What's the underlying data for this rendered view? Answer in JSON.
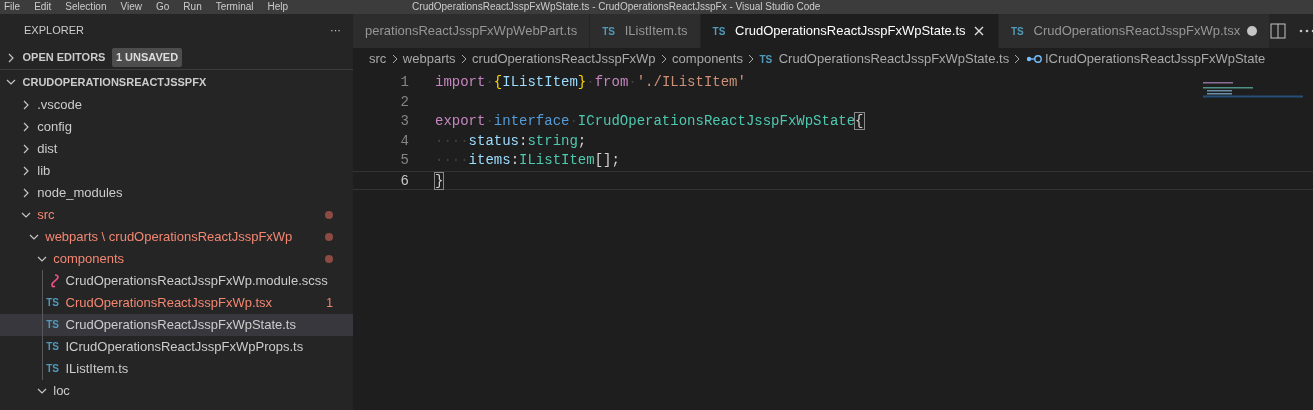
{
  "menu_bar": {
    "items": [
      "File",
      "Edit",
      "Selection",
      "View",
      "Go",
      "Run",
      "Terminal",
      "Help"
    ],
    "title": "CrudOperationsReactJsspFxWpState.ts - CrudOperationsReactJsspFx - Visual Studio Code"
  },
  "sidebar": {
    "title": "EXPLORER",
    "more": "···",
    "open_editors": {
      "label": "OPEN EDITORS",
      "expanded": false,
      "badge": "1 UNSAVED"
    },
    "project": {
      "label": "CRUDOPERATIONSREACTJSSPFX",
      "expanded": true
    },
    "tree": [
      {
        "label": ".vscode",
        "kind": "folder",
        "expanded": false,
        "modified": false
      },
      {
        "label": "config",
        "kind": "folder",
        "expanded": false,
        "modified": false
      },
      {
        "label": "dist",
        "kind": "folder",
        "expanded": false,
        "modified": false
      },
      {
        "label": "lib",
        "kind": "folder",
        "expanded": false,
        "modified": false
      },
      {
        "label": "node_modules",
        "kind": "folder",
        "expanded": false,
        "modified": false
      },
      {
        "label": "src",
        "kind": "folder",
        "expanded": true,
        "modified": true,
        "children": [
          {
            "label": "webparts \\ crudOperationsReactJsspFxWp",
            "kind": "folder",
            "expanded": true,
            "modified": true,
            "children": [
              {
                "label": "components",
                "kind": "folder",
                "expanded": true,
                "modified": true,
                "children": [
                  {
                    "label": "CrudOperationsReactJsspFxWp.module.scss",
                    "kind": "scss",
                    "modified": false,
                    "selected": false
                  },
                  {
                    "label": "CrudOperationsReactJsspFxWp.tsx",
                    "kind": "ts",
                    "icon": "TS",
                    "modified": true,
                    "problems": "1",
                    "selected": false
                  },
                  {
                    "label": "CrudOperationsReactJsspFxWpState.ts",
                    "kind": "ts",
                    "icon": "TS",
                    "modified": false,
                    "selected": true
                  },
                  {
                    "label": "ICrudOperationsReactJsspFxWpProps.ts",
                    "kind": "ts",
                    "icon": "TS",
                    "modified": false,
                    "selected": false
                  },
                  {
                    "label": "IListItem.ts",
                    "kind": "ts",
                    "icon": "TS",
                    "modified": false,
                    "selected": false
                  }
                ]
              },
              {
                "label": "loc",
                "kind": "folder",
                "expanded": true,
                "modified": false
              }
            ]
          }
        ]
      }
    ]
  },
  "tabs": [
    {
      "label": "perationsReactJsspFxWpWebPart.ts",
      "selected": false,
      "dirty": false
    },
    {
      "icon": "TS",
      "label": "IListItem.ts",
      "selected": false,
      "dirty": false
    },
    {
      "icon": "TS",
      "label": "CrudOperationsReactJsspFxWpState.ts",
      "selected": true,
      "dirty": false
    },
    {
      "icon": "TS",
      "label": "CrudOperationsReactJsspFxWp.tsx",
      "selected": false,
      "dirty": true
    }
  ],
  "breadcrumb": [
    {
      "kind": "folder",
      "label": "src"
    },
    {
      "kind": "folder",
      "label": "webparts"
    },
    {
      "kind": "folder",
      "label": "crudOperationsReactJsspFxWp"
    },
    {
      "kind": "folder",
      "label": "components"
    },
    {
      "kind": "file",
      "icon": "TS",
      "label": "CrudOperationsReactJsspFxWpState.ts"
    },
    {
      "kind": "symbol",
      "label": "ICrudOperationsReactJsspFxWpState"
    }
  ],
  "code": [
    {
      "number": "1",
      "current": false,
      "tokens": [
        {
          "kind": "keyword",
          "text": "import"
        },
        {
          "kind": "space",
          "text": "·"
        },
        {
          "kind": "bracket",
          "text": "{"
        },
        {
          "kind": "variable",
          "text": "IListItem"
        },
        {
          "kind": "bracket",
          "text": "}"
        },
        {
          "kind": "space",
          "text": "·"
        },
        {
          "kind": "keyword",
          "text": "from"
        },
        {
          "kind": "space",
          "text": "·"
        },
        {
          "kind": "string",
          "text": "'./IListItem'"
        }
      ]
    },
    {
      "number": "2",
      "current": false
    },
    {
      "number": "3",
      "current": false,
      "tokens": [
        {
          "kind": "keyword",
          "text": "export"
        },
        {
          "kind": "space",
          "text": "·"
        },
        {
          "kind": "storage",
          "text": "interface"
        },
        {
          "kind": "space",
          "text": "·"
        },
        {
          "kind": "type",
          "text": "ICrudOperationsReactJsspFxWpState"
        },
        {
          "kind": "match",
          "text": "{"
        }
      ]
    },
    {
      "number": "4",
      "current": false,
      "tokens": [
        {
          "kind": "space",
          "text": "····"
        },
        {
          "kind": "variable",
          "text": "status"
        },
        {
          "kind": "plain",
          "text": ":"
        },
        {
          "kind": "type",
          "text": "string"
        },
        {
          "kind": "plain",
          "text": ";"
        }
      ]
    },
    {
      "number": "5",
      "current": false,
      "tokens": [
        {
          "kind": "space",
          "text": "····"
        },
        {
          "kind": "variable",
          "text": "items"
        },
        {
          "kind": "plain",
          "text": ":"
        },
        {
          "kind": "type",
          "text": "IListItem"
        },
        {
          "kind": "plain",
          "text": "[];"
        }
      ]
    },
    {
      "number": "6",
      "current": true,
      "tokens": [
        {
          "kind": "match",
          "text": "}"
        }
      ]
    }
  ]
}
